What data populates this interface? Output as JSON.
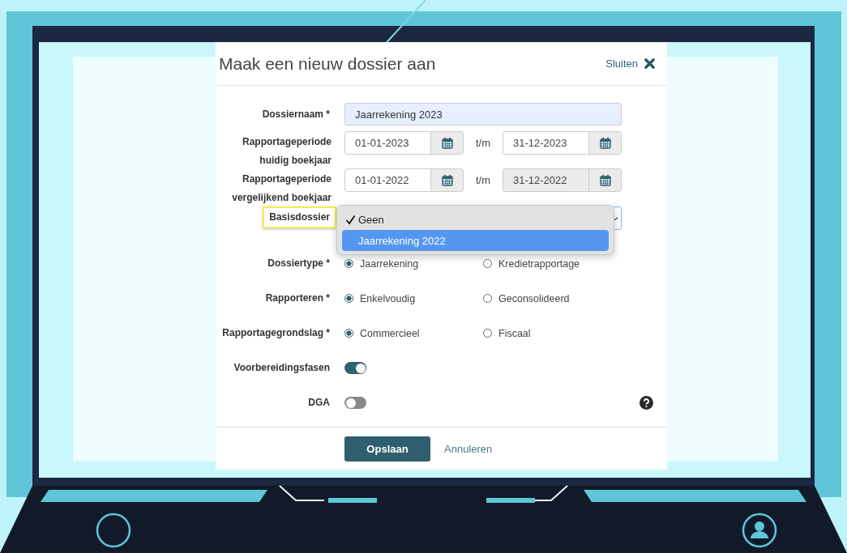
{
  "dialog": {
    "title": "Maak een nieuw dossier aan",
    "close_label": "Sluiten"
  },
  "fields": [
    {
      "kind": "text",
      "label": "Dossiernaam *",
      "value": "Jaarrekening 2023",
      "highlighted": false
    },
    {
      "kind": "daterange",
      "label": "Rapportageperiode huidig boekjaar",
      "from": {
        "value": "01-01-2023",
        "disabled": false
      },
      "separator": "t/m",
      "to": {
        "value": "31-12-2023",
        "disabled": false
      },
      "highlighted": false
    },
    {
      "kind": "daterange",
      "label": "Rapportageperiode vergelijkend boekjaar",
      "from": {
        "value": "01-01-2022",
        "disabled": false
      },
      "separator": "t/m",
      "to": {
        "value": "31-12-2022",
        "disabled": true
      },
      "highlighted": false
    },
    {
      "kind": "select",
      "label": "Basisdossier",
      "highlighted": true,
      "expanded": true,
      "options": [
        {
          "label": "Geen",
          "selected": true,
          "hovered": false
        },
        {
          "label": "Jaarrekening 2022",
          "selected": false,
          "hovered": true
        }
      ]
    },
    {
      "kind": "radio",
      "label": "Dossiertype *",
      "highlighted": false,
      "options": [
        {
          "label": "Jaarrekening",
          "selected": true
        },
        {
          "label": "Kredietrapportage",
          "selected": false
        }
      ]
    },
    {
      "kind": "radio",
      "label": "Rapporteren *",
      "highlighted": false,
      "options": [
        {
          "label": "Enkelvoudig",
          "selected": true
        },
        {
          "label": "Geconsolideerd",
          "selected": false
        }
      ]
    },
    {
      "kind": "radio",
      "label": "Rapportagegrondslag *",
      "highlighted": false,
      "options": [
        {
          "label": "Commercieel",
          "selected": true
        },
        {
          "label": "Fiscaal",
          "selected": false
        }
      ]
    },
    {
      "kind": "toggle",
      "label": "Voorbereidingsfasen",
      "on": true,
      "help": false,
      "highlighted": false
    },
    {
      "kind": "toggle",
      "label": "DGA",
      "on": false,
      "help": true,
      "highlighted": false
    }
  ],
  "buttons": [
    {
      "kind": "primary",
      "label": "Opslaan"
    },
    {
      "kind": "link",
      "label": "Annuleren"
    }
  ]
}
